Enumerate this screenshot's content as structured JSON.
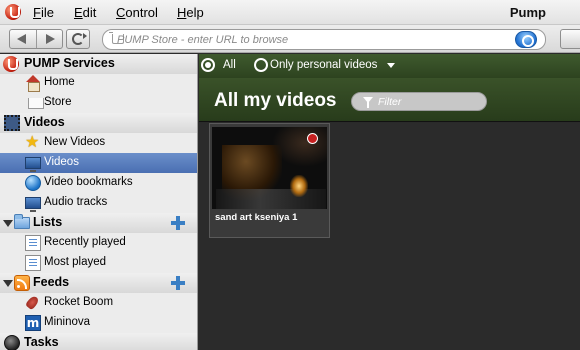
{
  "menubar": {
    "items": [
      {
        "mnemonic": "F",
        "rest": "ile"
      },
      {
        "mnemonic": "E",
        "rest": "dit"
      },
      {
        "mnemonic": "C",
        "rest": "ontrol"
      },
      {
        "mnemonic": "H",
        "rest": "elp"
      }
    ],
    "app_title": "Pump"
  },
  "toolbar": {
    "url_placeholder": "PUMP Store - enter URL to browse"
  },
  "sidebar": {
    "sections": {
      "pump_services": "PUMP Services",
      "videos": "Videos",
      "lists": "Lists",
      "feeds": "Feeds",
      "tasks": "Tasks"
    },
    "items": {
      "home": "Home",
      "store": "Store",
      "new_videos": "New Videos",
      "videos": "Videos",
      "video_bookmarks": "Video bookmarks",
      "audio_tracks": "Audio tracks",
      "recently_played": "Recently played",
      "most_played": "Most played",
      "rocket_boom": "Rocket Boom",
      "mininova": "Mininova"
    },
    "selected": "videos"
  },
  "main": {
    "filter_all": "All",
    "filter_personal": "Only personal videos",
    "title": "All my videos",
    "filter_placeholder": "Filter",
    "videos": [
      {
        "title": "sand art kseniya 1"
      }
    ]
  },
  "colors": {
    "accent_green": "#3a5229",
    "selection_blue": "#4a6fb2"
  }
}
